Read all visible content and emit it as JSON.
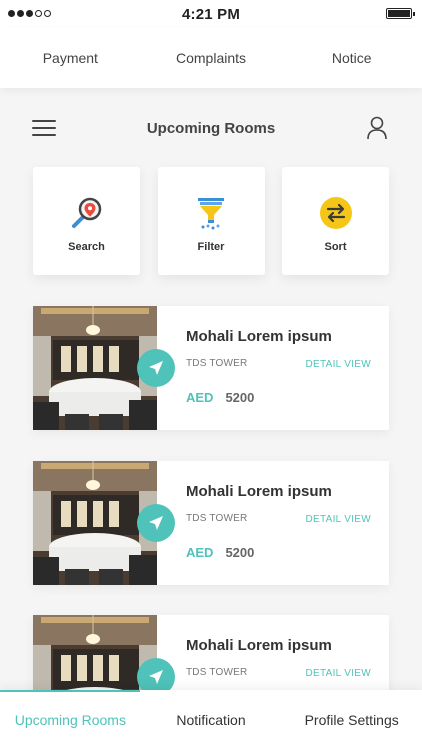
{
  "status_bar": {
    "time": "4:21 PM"
  },
  "top_nav": {
    "items": [
      "Payment",
      "Complaints",
      "Notice"
    ]
  },
  "header": {
    "title": "Upcoming Rooms"
  },
  "actions": [
    {
      "label": "Search",
      "icon": "search-location-icon"
    },
    {
      "label": "Filter",
      "icon": "filter-icon"
    },
    {
      "label": "Sort",
      "icon": "sort-icon"
    }
  ],
  "rooms": [
    {
      "name": "Mohali Lorem ipsum",
      "building": "TDS TOWER",
      "detail_label": "DETAIL VIEW",
      "currency": "AED",
      "price": "5200"
    },
    {
      "name": "Mohali Lorem ipsum",
      "building": "TDS TOWER",
      "detail_label": "DETAIL VIEW",
      "currency": "AED",
      "price": "5200"
    },
    {
      "name": "Mohali Lorem ipsum",
      "building": "TDS TOWER",
      "detail_label": "DETAIL VIEW"
    }
  ],
  "bottom_nav": {
    "tabs": [
      "Upcoming Rooms",
      "Notification",
      "Profile Settings"
    ],
    "active": "Upcoming Rooms"
  },
  "colors": {
    "accent": "#4fc3b9",
    "text": "#333333",
    "background": "#f5f5f5"
  }
}
